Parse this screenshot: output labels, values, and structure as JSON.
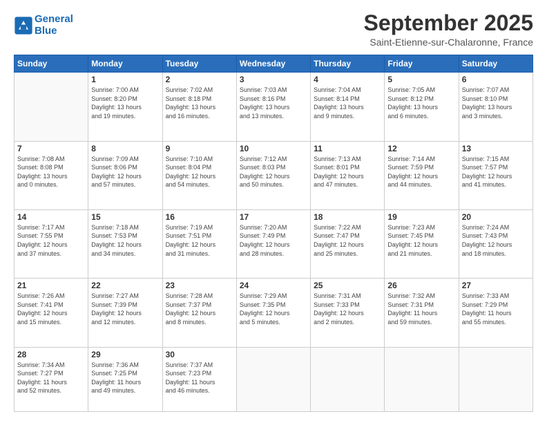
{
  "logo": {
    "line1": "General",
    "line2": "Blue"
  },
  "title": "September 2025",
  "location": "Saint-Etienne-sur-Chalaronne, France",
  "weekdays": [
    "Sunday",
    "Monday",
    "Tuesday",
    "Wednesday",
    "Thursday",
    "Friday",
    "Saturday"
  ],
  "days": [
    {
      "date": "",
      "detail": ""
    },
    {
      "date": "1",
      "detail": "Sunrise: 7:00 AM\nSunset: 8:20 PM\nDaylight: 13 hours\nand 19 minutes."
    },
    {
      "date": "2",
      "detail": "Sunrise: 7:02 AM\nSunset: 8:18 PM\nDaylight: 13 hours\nand 16 minutes."
    },
    {
      "date": "3",
      "detail": "Sunrise: 7:03 AM\nSunset: 8:16 PM\nDaylight: 13 hours\nand 13 minutes."
    },
    {
      "date": "4",
      "detail": "Sunrise: 7:04 AM\nSunset: 8:14 PM\nDaylight: 13 hours\nand 9 minutes."
    },
    {
      "date": "5",
      "detail": "Sunrise: 7:05 AM\nSunset: 8:12 PM\nDaylight: 13 hours\nand 6 minutes."
    },
    {
      "date": "6",
      "detail": "Sunrise: 7:07 AM\nSunset: 8:10 PM\nDaylight: 13 hours\nand 3 minutes."
    },
    {
      "date": "7",
      "detail": "Sunrise: 7:08 AM\nSunset: 8:08 PM\nDaylight: 13 hours\nand 0 minutes."
    },
    {
      "date": "8",
      "detail": "Sunrise: 7:09 AM\nSunset: 8:06 PM\nDaylight: 12 hours\nand 57 minutes."
    },
    {
      "date": "9",
      "detail": "Sunrise: 7:10 AM\nSunset: 8:04 PM\nDaylight: 12 hours\nand 54 minutes."
    },
    {
      "date": "10",
      "detail": "Sunrise: 7:12 AM\nSunset: 8:03 PM\nDaylight: 12 hours\nand 50 minutes."
    },
    {
      "date": "11",
      "detail": "Sunrise: 7:13 AM\nSunset: 8:01 PM\nDaylight: 12 hours\nand 47 minutes."
    },
    {
      "date": "12",
      "detail": "Sunrise: 7:14 AM\nSunset: 7:59 PM\nDaylight: 12 hours\nand 44 minutes."
    },
    {
      "date": "13",
      "detail": "Sunrise: 7:15 AM\nSunset: 7:57 PM\nDaylight: 12 hours\nand 41 minutes."
    },
    {
      "date": "14",
      "detail": "Sunrise: 7:17 AM\nSunset: 7:55 PM\nDaylight: 12 hours\nand 37 minutes."
    },
    {
      "date": "15",
      "detail": "Sunrise: 7:18 AM\nSunset: 7:53 PM\nDaylight: 12 hours\nand 34 minutes."
    },
    {
      "date": "16",
      "detail": "Sunrise: 7:19 AM\nSunset: 7:51 PM\nDaylight: 12 hours\nand 31 minutes."
    },
    {
      "date": "17",
      "detail": "Sunrise: 7:20 AM\nSunset: 7:49 PM\nDaylight: 12 hours\nand 28 minutes."
    },
    {
      "date": "18",
      "detail": "Sunrise: 7:22 AM\nSunset: 7:47 PM\nDaylight: 12 hours\nand 25 minutes."
    },
    {
      "date": "19",
      "detail": "Sunrise: 7:23 AM\nSunset: 7:45 PM\nDaylight: 12 hours\nand 21 minutes."
    },
    {
      "date": "20",
      "detail": "Sunrise: 7:24 AM\nSunset: 7:43 PM\nDaylight: 12 hours\nand 18 minutes."
    },
    {
      "date": "21",
      "detail": "Sunrise: 7:26 AM\nSunset: 7:41 PM\nDaylight: 12 hours\nand 15 minutes."
    },
    {
      "date": "22",
      "detail": "Sunrise: 7:27 AM\nSunset: 7:39 PM\nDaylight: 12 hours\nand 12 minutes."
    },
    {
      "date": "23",
      "detail": "Sunrise: 7:28 AM\nSunset: 7:37 PM\nDaylight: 12 hours\nand 8 minutes."
    },
    {
      "date": "24",
      "detail": "Sunrise: 7:29 AM\nSunset: 7:35 PM\nDaylight: 12 hours\nand 5 minutes."
    },
    {
      "date": "25",
      "detail": "Sunrise: 7:31 AM\nSunset: 7:33 PM\nDaylight: 12 hours\nand 2 minutes."
    },
    {
      "date": "26",
      "detail": "Sunrise: 7:32 AM\nSunset: 7:31 PM\nDaylight: 11 hours\nand 59 minutes."
    },
    {
      "date": "27",
      "detail": "Sunrise: 7:33 AM\nSunset: 7:29 PM\nDaylight: 11 hours\nand 55 minutes."
    },
    {
      "date": "28",
      "detail": "Sunrise: 7:34 AM\nSunset: 7:27 PM\nDaylight: 11 hours\nand 52 minutes."
    },
    {
      "date": "29",
      "detail": "Sunrise: 7:36 AM\nSunset: 7:25 PM\nDaylight: 11 hours\nand 49 minutes."
    },
    {
      "date": "30",
      "detail": "Sunrise: 7:37 AM\nSunset: 7:23 PM\nDaylight: 11 hours\nand 46 minutes."
    },
    {
      "date": "",
      "detail": ""
    },
    {
      "date": "",
      "detail": ""
    },
    {
      "date": "",
      "detail": ""
    },
    {
      "date": "",
      "detail": ""
    }
  ]
}
